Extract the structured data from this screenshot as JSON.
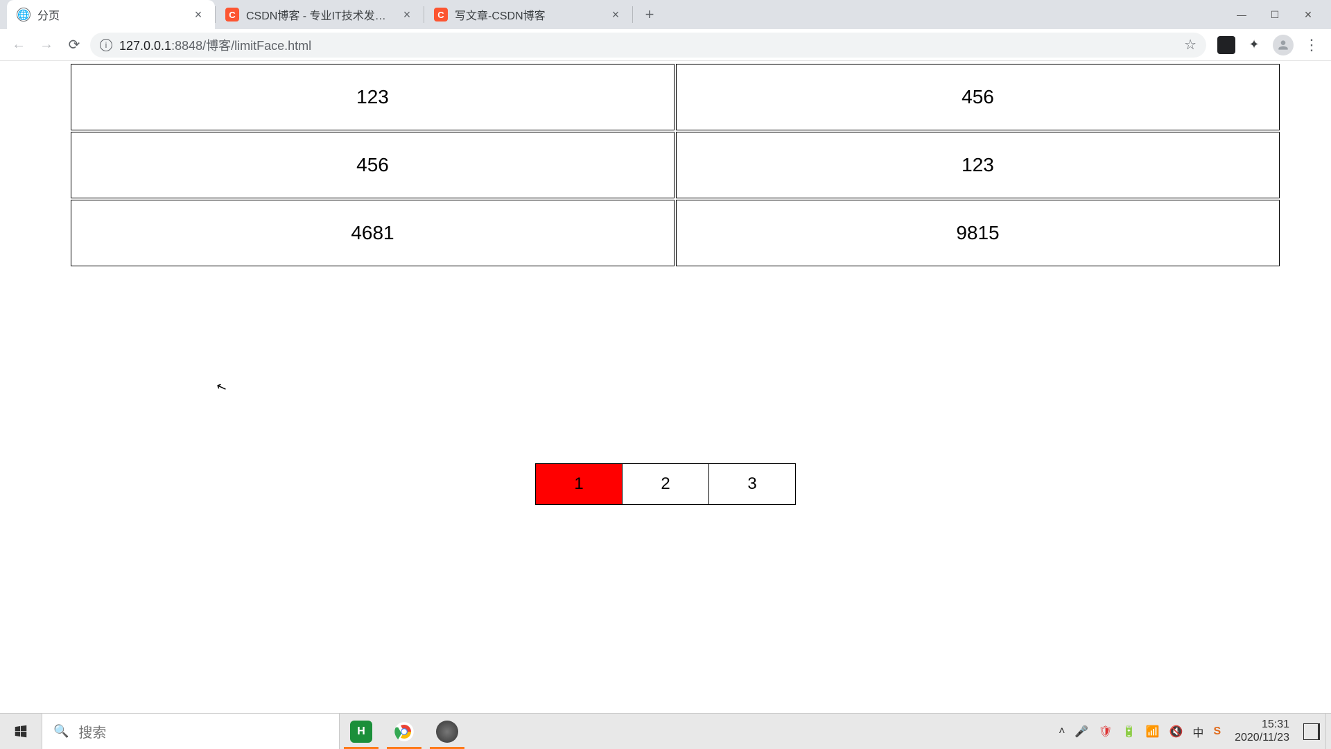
{
  "browser": {
    "tabs": [
      {
        "title": "分页",
        "favicon": "globe",
        "active": true
      },
      {
        "title": "CSDN博客 - 专业IT技术发表平台",
        "favicon": "csdn",
        "active": false
      },
      {
        "title": "写文章-CSDN博客",
        "favicon": "csdn",
        "active": false
      }
    ],
    "url_host": "127.0.0.1",
    "url_port": ":8848",
    "url_path": "/博客/limitFace.html"
  },
  "table": {
    "rows": [
      {
        "left": "123",
        "right": "456"
      },
      {
        "left": "456",
        "right": "123"
      },
      {
        "left": "4681",
        "right": "9815"
      }
    ]
  },
  "pagination": {
    "pages": [
      "1",
      "2",
      "3"
    ],
    "active_index": 0
  },
  "taskbar": {
    "search_placeholder": "搜索",
    "time": "15:31",
    "date": "2020/11/23"
  },
  "colors": {
    "active_page_bg": "#ff0000",
    "csdn": "#fc5531"
  }
}
